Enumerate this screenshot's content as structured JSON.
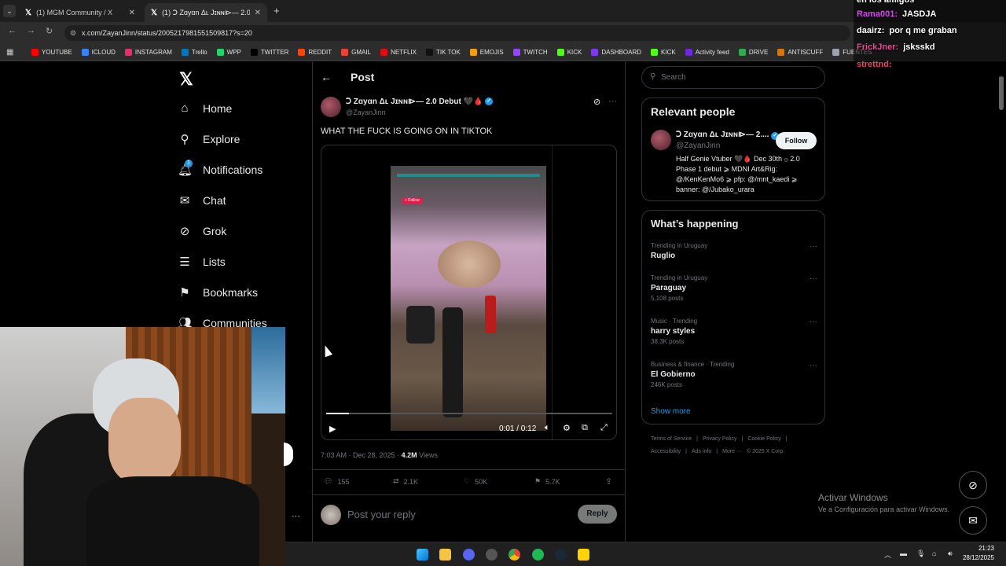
{
  "browser": {
    "tabs": [
      {
        "title": "(1) MGM Community / X",
        "active": false
      },
      {
        "title": "(1) Ↄ Zɑyɑn Δʟ Jɪɴɴ⧐— 2.0 Debut",
        "active": true
      }
    ],
    "new_tab": "+",
    "url": "x.com/ZayanJinn/status/2005217981551509817?s=20",
    "bookmarks": [
      {
        "label": "YOUTUBE",
        "color": "#ff0000"
      },
      {
        "label": "ICLOUD",
        "color": "#3b82f6"
      },
      {
        "label": "INSTAGRAM",
        "color": "#e1306c"
      },
      {
        "label": "Trello",
        "color": "#0079bf"
      },
      {
        "label": "WPP",
        "color": "#25d366"
      },
      {
        "label": "TWITTER",
        "color": "#000000"
      },
      {
        "label": "REDDIT",
        "color": "#ff4500"
      },
      {
        "label": "GMAIL",
        "color": "#ea4335"
      },
      {
        "label": "NETFLIX",
        "color": "#e50914"
      },
      {
        "label": "TIK TOK",
        "color": "#111111"
      },
      {
        "label": "EMOJIS",
        "color": "#f59e0b"
      },
      {
        "label": "TWITCH",
        "color": "#9146ff"
      },
      {
        "label": "KICK",
        "color": "#53fc18"
      },
      {
        "label": "DASHBOARD",
        "color": "#7c3aed"
      },
      {
        "label": "KICK",
        "color": "#53fc18"
      },
      {
        "label": "Activity feed",
        "color": "#6d28d9"
      },
      {
        "label": "DRIVE",
        "color": "#34a853"
      },
      {
        "label": "ANTISCUFF",
        "color": "#d97706"
      },
      {
        "label": "FUENTES",
        "color": "#9ca3af"
      }
    ]
  },
  "sidebar": {
    "items": [
      {
        "label": "Home",
        "icon": "home-icon"
      },
      {
        "label": "Explore",
        "icon": "search-icon"
      },
      {
        "label": "Notifications",
        "icon": "bell-icon",
        "badge": "1"
      },
      {
        "label": "Chat",
        "icon": "mail-icon"
      },
      {
        "label": "Grok",
        "icon": "grok-icon"
      },
      {
        "label": "Lists",
        "icon": "list-icon"
      },
      {
        "label": "Bookmarks",
        "icon": "bookmark-icon"
      },
      {
        "label": "Communities",
        "icon": "people-icon"
      }
    ],
    "more": "···"
  },
  "post": {
    "header": "Post",
    "author_name": "Ↄ Zɑyɑn Δʟ Jɪɴɴ⧐— 2.0 Debut 🖤🩸",
    "handle": "@ZayanJinn",
    "text": "WHAT THE FUCK IS GOING ON IN TIKTOK",
    "video": {
      "time": "0:01 / 0:12",
      "progress": 0.08,
      "follow_label": "+ Follow"
    },
    "timestamp": "7:03 AM · Dec 28, 2025 ·",
    "views_count": "4.2M",
    "views_label": "Views",
    "stats": {
      "replies": "155",
      "reposts": "2.1K",
      "likes": "50K",
      "bookmarks": "5.7K"
    },
    "reply_placeholder": "Post your reply",
    "reply_button": "Reply"
  },
  "right": {
    "search_placeholder": "Search",
    "relevant_title": "Relevant people",
    "person": {
      "name": "Ↄ Zɑyɑn Δʟ Jɪɴɴ⧐— 2....",
      "handle": "@ZayanJinn",
      "follow": "Follow",
      "bio": "Half Genie Vtuber 🖤🩸 Dec 30th ۞ 2.0 Phase 1 debut ⩾ MDNI Art&Rig: @/KenKenMo6 ⩾ pfp: @/mnt_kaedi ⩾ banner: @/Jubako_urara"
    },
    "happening_title": "What’s happening",
    "trends": [
      {
        "category": "Trending in Uruguay",
        "name": "Ruglio",
        "posts": ""
      },
      {
        "category": "Trending in Uruguay",
        "name": "Paraguay",
        "posts": "5,108 posts"
      },
      {
        "category": "Music · Trending",
        "name": "harry styles",
        "posts": "38.3K posts"
      },
      {
        "category": "Business & finance · Trending",
        "name": "El Gobierno",
        "posts": "246K posts"
      }
    ],
    "show_more": "Show more",
    "footer1": [
      "Terms of Service",
      "Privacy Policy",
      "Cookie Policy"
    ],
    "footer2": [
      "Accessibility",
      "Ads info",
      "More ···",
      "© 2025 X Corp."
    ]
  },
  "windows_watermark": {
    "title": "Activar Windows",
    "subtitle": "Ve a Configuración para activar Windows."
  },
  "chat_overlay": {
    "lines": [
      {
        "user": "en los amigos",
        "msg": "",
        "color": "#ffffff"
      },
      {
        "user": "Rama001:",
        "msg": "JASDJA",
        "color": "#d946ef"
      },
      {
        "user": "daairz:",
        "msg": "por q me graban",
        "color": "#ffffff"
      },
      {
        "user": "FrickJner:",
        "msg": "jsksskd",
        "color": "#ec4899"
      },
      {
        "user": "strettnd:",
        "msg": "",
        "color": "#f43f5e"
      }
    ]
  },
  "taskbar": {
    "time": "21:23",
    "date": "28/12/2025"
  }
}
